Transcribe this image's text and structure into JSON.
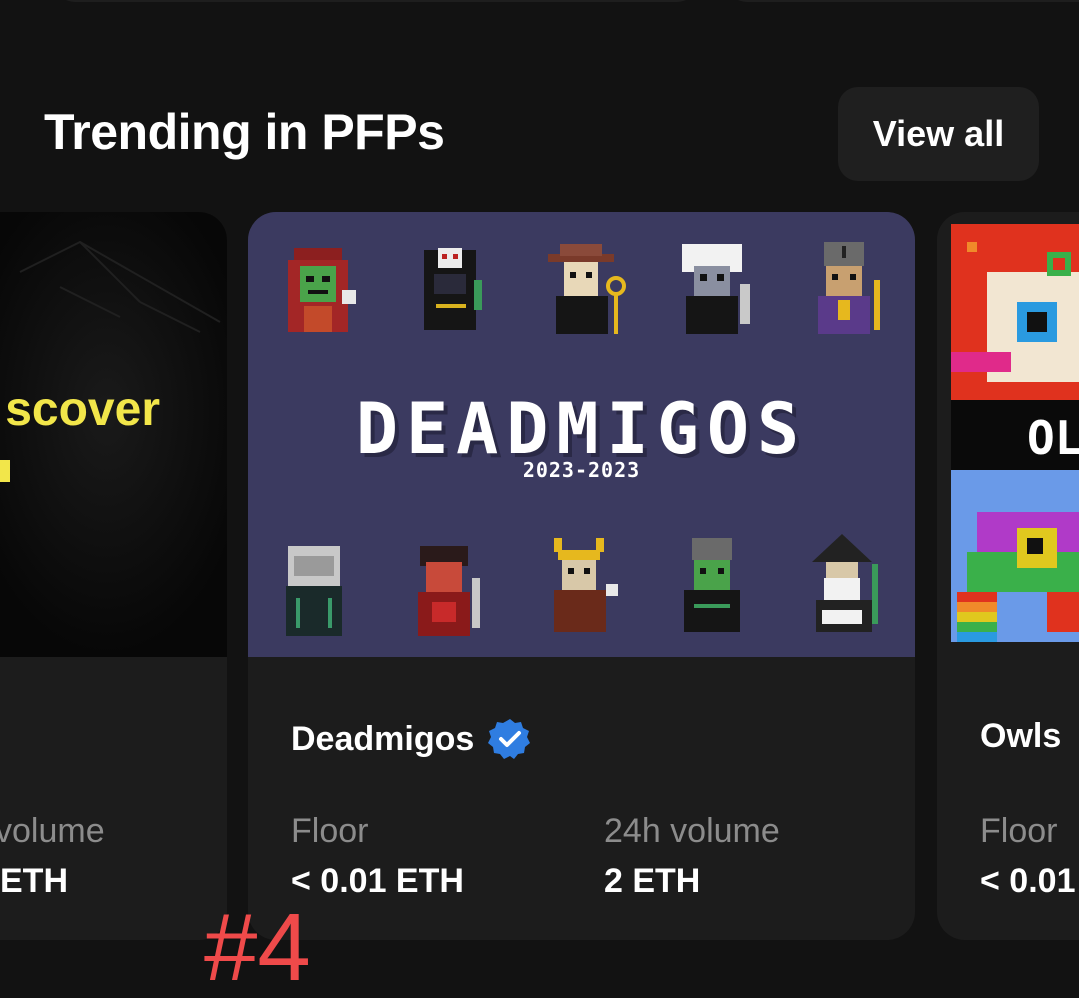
{
  "section": {
    "title": "Trending in PFPs",
    "view_all_label": "View all"
  },
  "cards": {
    "left": {
      "promo_text": "scover",
      "stat_label": "volume",
      "stat_value": "ETH"
    },
    "main": {
      "name": "Deadmigos",
      "verified": true,
      "logo_text": "DEADMIGOS",
      "logo_years": "2023-2023",
      "floor_label": "Floor",
      "floor_value": "< 0.01 ETH",
      "volume_label": "24h volume",
      "volume_value": "2 ETH"
    },
    "right": {
      "name": "Owls",
      "image_text": "OL",
      "floor_label": "Floor",
      "floor_value": "< 0.01"
    }
  },
  "annotation": "#4",
  "colors": {
    "background": "#121212",
    "card": "#1c1c1c",
    "deadmigos_bg": "#3b3a60",
    "verified_blue": "#2f7de1",
    "promo_yellow": "#f2e64a",
    "annotation_red": "#ef4a4a",
    "muted_text": "#8c8c8c"
  }
}
